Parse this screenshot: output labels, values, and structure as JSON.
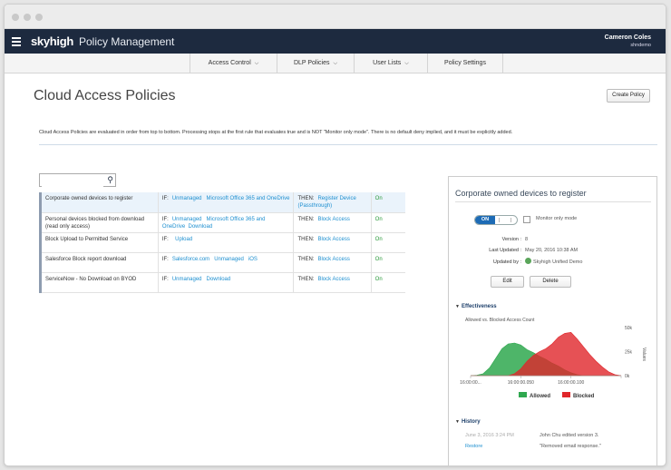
{
  "app": {
    "brand": "skyhigh",
    "title": "Policy Management",
    "user_name": "Cameron Coles",
    "user_id": "shndemo"
  },
  "tabs": [
    {
      "label": "Access Control",
      "chevron": "chevron-down-icon"
    },
    {
      "label": "DLP Policies",
      "chevron": "chevron-down-icon"
    },
    {
      "label": "User Lists",
      "chevron": "chevron-down-icon"
    },
    {
      "label": "Policy Settings"
    }
  ],
  "page": {
    "title": "Cloud Access Policies",
    "create_label": "Create Policy",
    "description": "Cloud Access Policies are evaluated in order from top to bottom. Processing stops at the first rule that evaluates true and is NOT \"Monitor only mode\". There is no default deny implied, and it must be explicitly added.",
    "search_value": ""
  },
  "policies": [
    {
      "name": "Corporate owned devices to register",
      "if_label": "IF:",
      "conditions": [
        "Unmanaged",
        "Microsoft Office 365 and OneDrive"
      ],
      "then_label": "THEN:",
      "action": "Register Device (Passthrough)",
      "status": "On"
    },
    {
      "name": "Personal devices blocked from download (read only access)",
      "if_label": "IF:",
      "conditions": [
        "Unmanaged",
        "Microsoft Office 365 and OneDrive",
        "Download"
      ],
      "then_label": "THEN:",
      "action": "Block Access",
      "status": "On"
    },
    {
      "name": "Block Upload to Permitted Service",
      "if_label": "IF:",
      "conditions": [
        "Upload"
      ],
      "then_label": "THEN:",
      "action": "Block Access",
      "status": "On"
    },
    {
      "name": "Salesforce Block report download",
      "if_label": "IF:",
      "conditions": [
        "Salesforce.com",
        "Unmanaged",
        "iOS"
      ],
      "then_label": "THEN:",
      "action": "Block Access",
      "status": "On"
    },
    {
      "name": "ServiceNow - No Download on BYOD",
      "if_label": "IF:",
      "conditions": [
        "Unmanaged",
        "Download"
      ],
      "then_label": "THEN:",
      "action": "Block Access",
      "status": "On"
    }
  ],
  "detail": {
    "title": "Corporate owned devices to register",
    "toggle_label": "ON",
    "monitor_label": "Monitor only mode",
    "version_label": "Version :",
    "version": "8",
    "updated_label": "Last Updated :",
    "updated": "May 20, 2016 10:38 AM",
    "by_label": "Updated by :",
    "by": "Skyhigh Unified Demo",
    "edit_label": "Edit",
    "delete_label": "Delete",
    "effectiveness_label": "Effectiveness",
    "chart_title": "Allowed vs. Blocked Access Count",
    "history_label": "History",
    "history": [
      {
        "date": "June 3, 2016 3:24 PM",
        "action": "Restore",
        "text": "John Chu edited version 3.",
        "note": "\"Removed email response.\""
      }
    ]
  },
  "colors": {
    "allowed": "#2fa84f",
    "blocked": "#e0262a",
    "brand": "#1d2a3f",
    "link": "#1d8fd0"
  },
  "chart_data": {
    "type": "area",
    "title": "Allowed vs. Blocked Access Count",
    "ylabel": "Values",
    "ylim": [
      0,
      50000
    ],
    "yticks": [
      "50k",
      "25k",
      "0k"
    ],
    "xticks": [
      "16:00:00...",
      "16:00:00.050",
      "16:00:00.100",
      ""
    ],
    "x": [
      0,
      5,
      10,
      15,
      20,
      25,
      30,
      35,
      40,
      45,
      50,
      55,
      60,
      65,
      70,
      75,
      80,
      85,
      90,
      95,
      100,
      105,
      110,
      115,
      120
    ],
    "series": [
      {
        "name": "Allowed",
        "color": "#2fa84f",
        "values": [
          0,
          500,
          2000,
          8000,
          18000,
          28000,
          33000,
          34000,
          32000,
          27000,
          24000,
          20000,
          17000,
          13000,
          10000,
          6000,
          3000,
          1000,
          0,
          0,
          0,
          0,
          0,
          0,
          0
        ]
      },
      {
        "name": "Blocked",
        "color": "#e0262a",
        "values": [
          0,
          0,
          0,
          0,
          0,
          0,
          0,
          2000,
          7000,
          15000,
          21000,
          25000,
          28000,
          33000,
          40000,
          44000,
          45000,
          38000,
          30000,
          22000,
          15000,
          9000,
          4000,
          1000,
          0
        ]
      }
    ],
    "legend_position": "bottom"
  }
}
